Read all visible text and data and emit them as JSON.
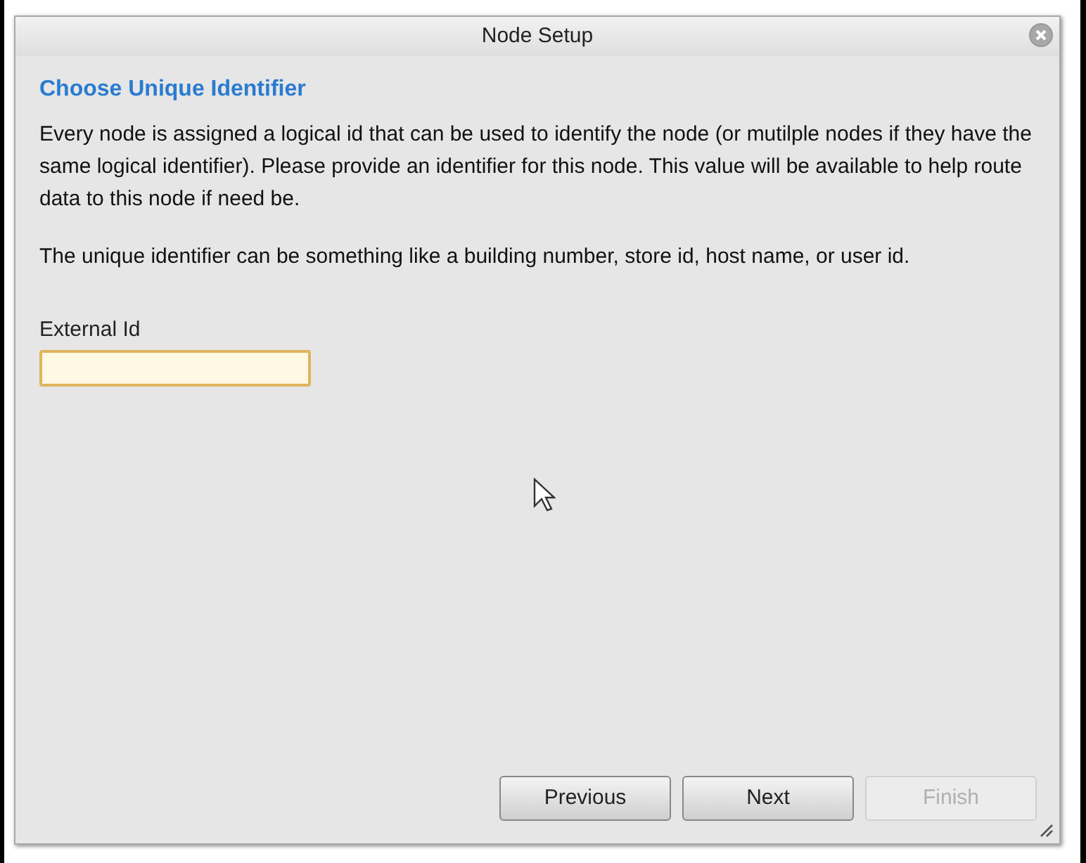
{
  "window": {
    "title": "Node Setup"
  },
  "heading": "Choose Unique Identifier",
  "paragraphs": [
    "Every node is assigned a logical id that can be used to identify the node (or mutilple nodes if they have the same logical identifier). Please provide an identifier for this node. This value will be available to help route data to this node if need be.",
    "The unique identifier can be something like a building number, store id, host name, or user id."
  ],
  "field": {
    "label": "External Id"
  },
  "buttons": [
    {
      "label": "Previous",
      "disabled": false
    },
    {
      "label": "Next",
      "disabled": false
    },
    {
      "label": "Finish",
      "disabled": true
    }
  ]
}
